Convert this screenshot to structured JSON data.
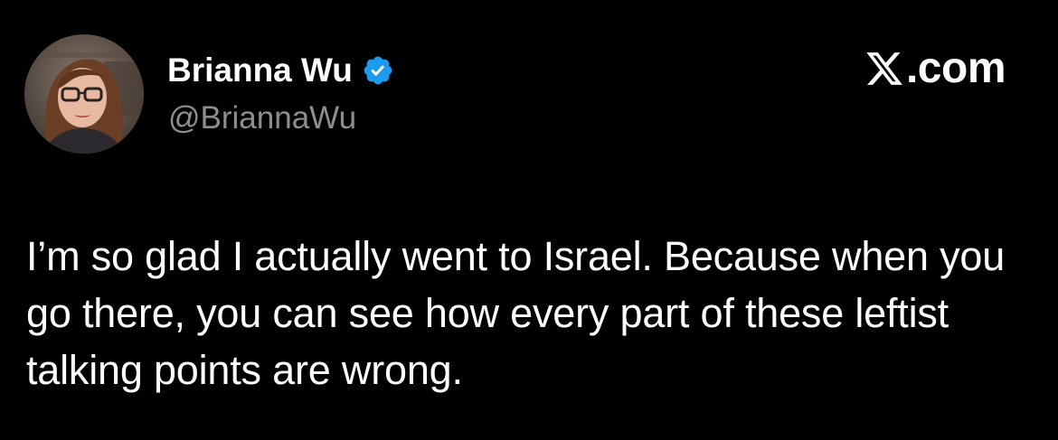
{
  "author": {
    "display_name": "Brianna Wu",
    "handle": "@BriannaWu",
    "verified": true,
    "avatar": "profile-photo"
  },
  "brand": {
    "text": ".com",
    "logo_icon": "x-logo-icon"
  },
  "tweet": {
    "text": "I’m so glad I actually went to Israel. Because when you go there, you can see how every part of these leftist talking points are wrong."
  },
  "colors": {
    "background": "#000000",
    "text_primary": "#ffffff",
    "text_secondary": "#8b8f94",
    "verified_badge": "#1d9bf0"
  }
}
